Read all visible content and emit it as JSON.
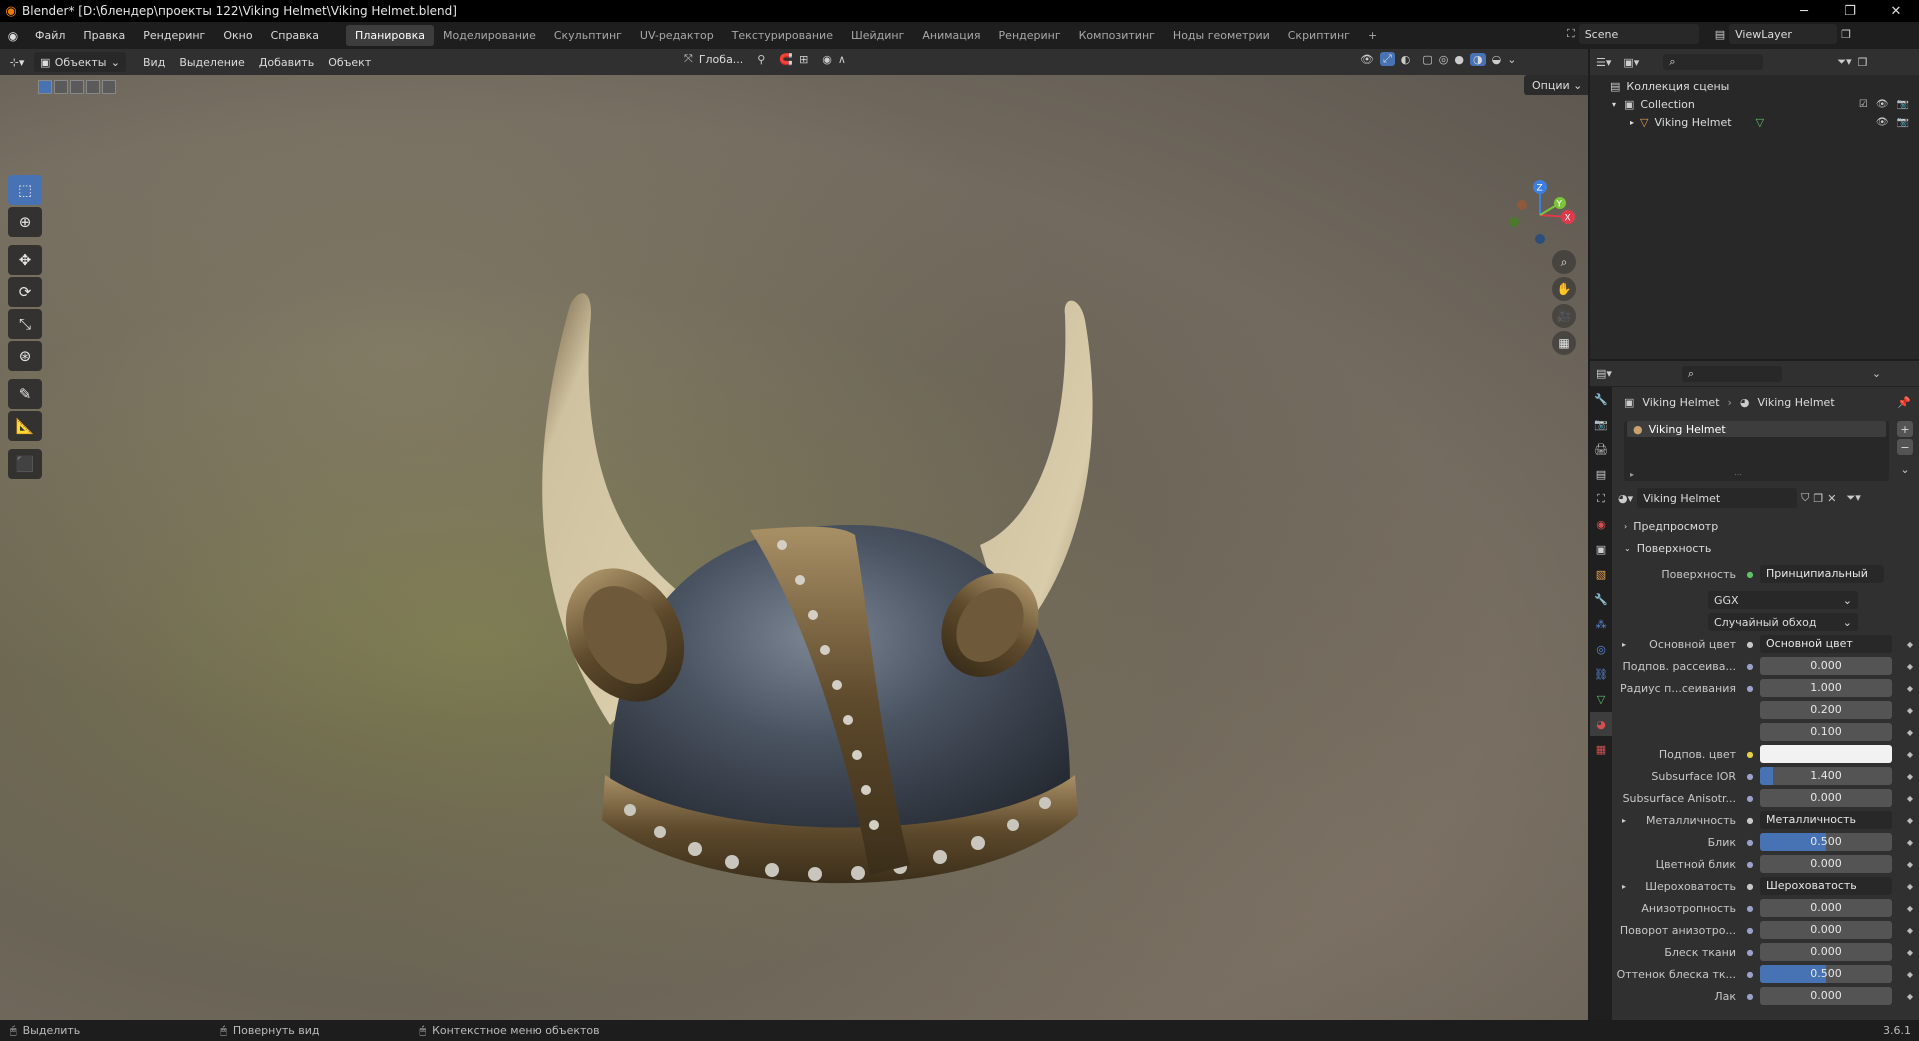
{
  "window": {
    "title": "Blender* [D:\\блендер\\проекты 122\\Viking Helmet\\Viking Helmet.blend]"
  },
  "menubar": {
    "items": [
      "Файл",
      "Правка",
      "Рендеринг",
      "Окно",
      "Справка"
    ],
    "workspaces": [
      "Планировка",
      "Моделирование",
      "Скульптинг",
      "UV-редактор",
      "Текстурирование",
      "Шейдинг",
      "Анимация",
      "Рендеринг",
      "Композитинг",
      "Ноды геометрии",
      "Скриптинг"
    ],
    "active_workspace": "Планировка",
    "add_tab": "+",
    "scene": "Scene",
    "view_layer": "ViewLayer"
  },
  "viewport_header": {
    "mode": "Объекты",
    "menus": [
      "Вид",
      "Выделение",
      "Добавить",
      "Объект"
    ],
    "orientation": "Глоба...",
    "options": "Опции"
  },
  "gizmo": {
    "x": "X",
    "y": "Y",
    "z": "Z"
  },
  "outliner": {
    "scene_collection": "Коллекция сцены",
    "collection": "Collection",
    "object": "Viking Helmet"
  },
  "properties": {
    "breadcrumb": [
      "Viking Helmet",
      "Viking Helmet"
    ],
    "slot": "Viking Helmet",
    "material_name": "Viking Helmet",
    "panels": {
      "preview": "Предпросмотр",
      "surface": "Поверхность"
    },
    "surface_label": "Поверхность",
    "surface_shader": "Принципиальный BSDF",
    "distribution": "GGX",
    "subsurface_method": "Случайный обход",
    "rows": [
      {
        "label": "Основной цвет",
        "value": "Основной цвет",
        "kind": "link",
        "expand": true
      },
      {
        "label": "Подпов. рассеива...",
        "value": "0.000",
        "kind": "num"
      },
      {
        "label": "Радиус п...сеивания",
        "value": "1.000",
        "kind": "num"
      },
      {
        "label": "",
        "value": "0.200",
        "kind": "num"
      },
      {
        "label": "",
        "value": "0.100",
        "kind": "num"
      },
      {
        "label": "Подпов. цвет",
        "value": "",
        "kind": "color"
      },
      {
        "label": "Subsurface IOR",
        "value": "1.400",
        "kind": "slider",
        "fill": 0.1
      },
      {
        "label": "Subsurface Anisotr...",
        "value": "0.000",
        "kind": "num"
      },
      {
        "label": "Металличность",
        "value": "Металличность",
        "kind": "link",
        "expand": true
      },
      {
        "label": "Блик",
        "value": "0.500",
        "kind": "slider",
        "fill": 0.5
      },
      {
        "label": "Цветной блик",
        "value": "0.000",
        "kind": "num"
      },
      {
        "label": "Шероховатость",
        "value": "Шероховатость",
        "kind": "link",
        "expand": true
      },
      {
        "label": "Анизотропность",
        "value": "0.000",
        "kind": "num"
      },
      {
        "label": "Поворот анизотро...",
        "value": "0.000",
        "kind": "num"
      },
      {
        "label": "Блеск ткани",
        "value": "0.000",
        "kind": "num"
      },
      {
        "label": "Оттенок блеска тк...",
        "value": "0.500",
        "kind": "slider",
        "fill": 0.5
      },
      {
        "label": "Лак",
        "value": "0.000",
        "kind": "num"
      }
    ]
  },
  "statusbar": {
    "select": "Выделить",
    "rotate": "Повернуть вид",
    "context_menu": "Контекстное меню объектов",
    "version": "3.6.1"
  },
  "colors": {
    "accent": "#4772b3",
    "orange": "#e87d0d",
    "axis_x": "#e03a4a",
    "axis_y": "#7cc43a",
    "axis_z": "#3c7fe0"
  }
}
